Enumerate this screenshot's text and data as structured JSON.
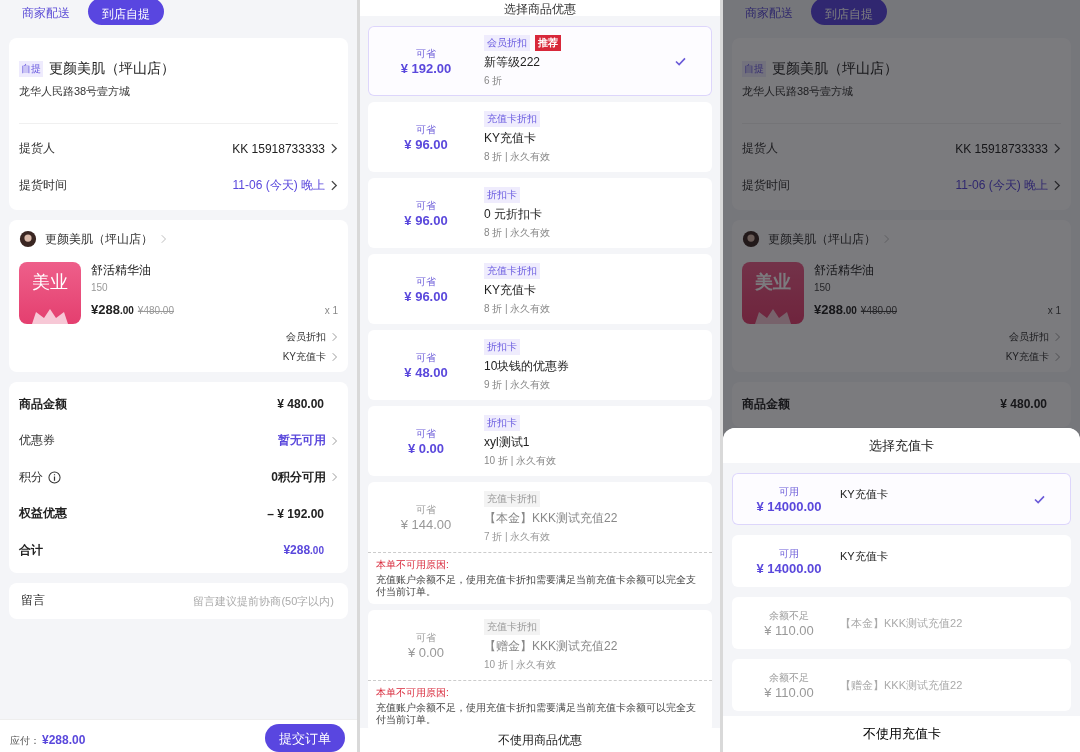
{
  "screens": [
    {
      "kind": "order",
      "order": {
        "delivery_tabs": [
          {
            "label": "商家配送",
            "selected": false
          },
          {
            "label": "到店自提",
            "selected": true
          }
        ],
        "pickup": {
          "tag": "自提",
          "store": "更颜美肌（坪山店）",
          "address": "龙华人民路38号壹方城",
          "rows": [
            {
              "label": "提货人",
              "value": "KK  15918733333",
              "accent": false
            },
            {
              "label": "提货时间",
              "value": "11-06 (今天) 晚上",
              "accent": true
            }
          ]
        },
        "shop": {
          "name": "更颜美肌（坪山店）"
        },
        "product": {
          "logo_text": "美业",
          "name": "舒活精华油",
          "spec": "150",
          "price": "¥288",
          "price_cents": ".00",
          "original_price": "¥480.00",
          "qty": "x 1"
        },
        "discount_links": [
          "会员折扣",
          "KY充值卡"
        ],
        "summary": [
          {
            "kind": "amount",
            "label": "商品金额",
            "value": "¥ 480.00"
          },
          {
            "kind": "link",
            "label": "优惠券",
            "value": "暂无可用",
            "accent": true,
            "info": false
          },
          {
            "kind": "link",
            "label": "积分",
            "value": "0积分可用",
            "accent": false,
            "info": true
          },
          {
            "kind": "amount",
            "label": "权益优惠",
            "value": "– ¥ 192.00"
          },
          {
            "kind": "total",
            "label": "合计",
            "value": "¥288",
            "cents": ".00"
          }
        ],
        "message": {
          "label": "留言",
          "placeholder": "留言建议提前协商(50字以内)"
        },
        "footer": {
          "due_label": "应付：",
          "due_value": "¥288.00",
          "submit": "提交订单"
        }
      }
    },
    {
      "kind": "picker",
      "title": "选择商品优惠",
      "items": [
        {
          "save_label": "可省",
          "amount": "¥ 192.00",
          "tag": "会员折扣",
          "badge": "推荐",
          "name": "新等级222",
          "detail": "6 折",
          "selected": true,
          "disabled": false
        },
        {
          "save_label": "可省",
          "amount": "¥ 96.00",
          "tag": "充值卡折扣",
          "name": "KY充值卡",
          "detail": "8 折 | 永久有效",
          "selected": false,
          "disabled": false
        },
        {
          "save_label": "可省",
          "amount": "¥ 96.00",
          "tag": "折扣卡",
          "name": "0 元折扣卡",
          "detail": "8 折 | 永久有效",
          "selected": false,
          "disabled": false
        },
        {
          "save_label": "可省",
          "amount": "¥ 96.00",
          "tag": "充值卡折扣",
          "name": "KY充值卡",
          "detail": "8 折 | 永久有效",
          "selected": false,
          "disabled": false
        },
        {
          "save_label": "可省",
          "amount": "¥ 48.00",
          "tag": "折扣卡",
          "name": "10块钱的优惠券",
          "detail": "9 折 | 永久有效",
          "selected": false,
          "disabled": false
        },
        {
          "save_label": "可省",
          "amount": "¥ 0.00",
          "tag": "折扣卡",
          "name": "xyl测试1",
          "detail": "10 折 | 永久有效",
          "selected": false,
          "disabled": false
        },
        {
          "save_label": "可省",
          "amount": "¥ 144.00",
          "tag": "充值卡折扣",
          "name": "【本金】KKK测试充值22",
          "detail": "7 折 | 永久有效",
          "selected": false,
          "disabled": true,
          "reason_title": "本单不可用原因:",
          "reason": "充值账户余额不足，使用充值卡折扣需要满足当前充值卡余额可以完全支付当前订单。"
        },
        {
          "save_label": "可省",
          "amount": "¥ 0.00",
          "tag": "充值卡折扣",
          "name": "【赠金】KKK测试充值22",
          "detail": "10 折 | 永久有效",
          "selected": false,
          "disabled": true,
          "reason_title": "本单不可用原因:",
          "reason": "充值账户余额不足，使用充值卡折扣需要满足当前充值卡余额可以完全支付当前订单。"
        }
      ],
      "footer": "不使用商品优惠"
    },
    {
      "kind": "order",
      "order": {
        "delivery_tabs": [
          {
            "label": "商家配送",
            "selected": false
          },
          {
            "label": "到店自提",
            "selected": true
          }
        ],
        "pickup": {
          "tag": "自提",
          "store": "更颜美肌（坪山店）",
          "address": "龙华人民路38号壹方城",
          "rows": [
            {
              "label": "提货人",
              "value": "KK  15918733333",
              "accent": false
            },
            {
              "label": "提货时间",
              "value": "11-06 (今天) 晚上",
              "accent": true
            }
          ]
        },
        "shop": {
          "name": "更颜美肌（坪山店）"
        },
        "product": {
          "logo_text": "美业",
          "name": "舒活精华油",
          "spec": "150",
          "price": "¥288",
          "price_cents": ".00",
          "original_price": "¥480.00",
          "qty": "x 1"
        },
        "discount_links": [
          "会员折扣",
          "KY充值卡"
        ],
        "summary": [
          {
            "kind": "amount",
            "label": "商品金额",
            "value": "¥ 480.00"
          }
        ]
      },
      "sheet": {
        "title": "选择充值卡",
        "cards": [
          {
            "label": "可用",
            "amount": "¥ 14000.00",
            "name": "KY充值卡",
            "selected": true,
            "disabled": false
          },
          {
            "label": "可用",
            "amount": "¥ 14000.00",
            "name": "KY充值卡",
            "selected": false,
            "disabled": false
          },
          {
            "label": "余额不足",
            "amount": "¥ 110.00",
            "name": "【本金】KKK测试充值22",
            "selected": false,
            "disabled": true
          },
          {
            "label": "余额不足",
            "amount": "¥ 110.00",
            "name": "【赠金】KKK测试充值22",
            "selected": false,
            "disabled": true
          }
        ],
        "footer": "不使用充值卡"
      }
    }
  ]
}
